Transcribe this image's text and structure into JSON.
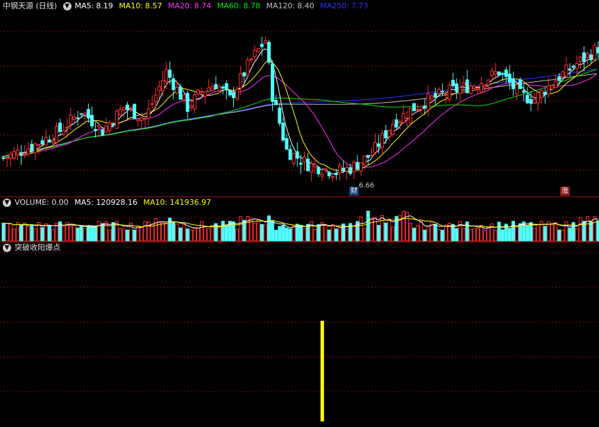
{
  "price_header": {
    "stock_title": "中钢天源 (日线)",
    "ma5_label": "MA5:",
    "ma5_value": "8.19",
    "ma10_label": "MA10:",
    "ma10_value": "8.57",
    "ma20_label": "MA20:",
    "ma20_value": "8.74",
    "ma60_label": "MA60:",
    "ma60_value": "8.78",
    "ma120_label": "MA120:",
    "ma120_value": "8.40",
    "ma250_label": "MA250:",
    "ma250_value": "7.73"
  },
  "price_chart": {
    "low_label": "6.66",
    "marker_cai": "财",
    "marker_zhang": "涨"
  },
  "volume_header": {
    "volume_label": "VOLUME: 0.00",
    "ma5_label": "MA5: 120928.16",
    "ma10_label": "MA10: 141936.97"
  },
  "indicator_header": {
    "name": "突破收阳爆点"
  },
  "colors": {
    "up": "#ff3232",
    "down": "#54ffff",
    "ma5": "#ffffff",
    "ma10": "#ffff00",
    "ma20": "#ff32ff",
    "ma60": "#00e600",
    "ma120": "#c0c0c0",
    "ma250": "#3232ff",
    "signal": "#ffff00",
    "grid": "#8b0000"
  },
  "indicator": {
    "signal_index": 88
  }
}
